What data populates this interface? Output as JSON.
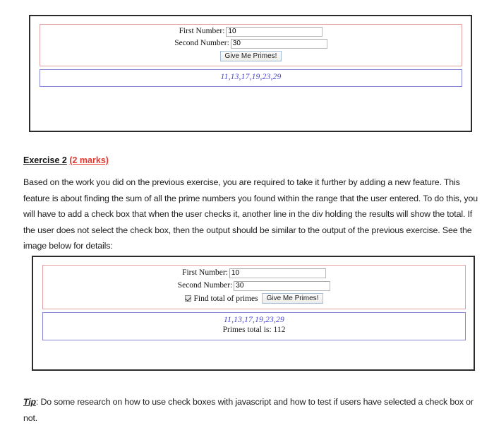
{
  "figure_1": {
    "name": "prime-finder-screenshot-basic",
    "form": {
      "first_number_label": "First Number:",
      "first_number_value": "10",
      "second_number_label": "Second Number:",
      "second_number_value": "30",
      "submit_label": "Give Me Primes!"
    },
    "results": {
      "primes_line": "11,13,17,19,23,29"
    }
  },
  "exercise": {
    "heading_main": "Exercise 2",
    "heading_marks": "(2 marks)",
    "paragraph": "Based on the work you did on the previous exercise, you are required to take it further by adding a new feature. This feature is about finding the sum of all the prime numbers you found within the range that the user entered. To do this, you will have to add a check box that when the user checks it, another line in the div holding the results will show the total. If the user does not select the check box, then the output should be similar to the output of the previous exercise. See the image below for details:"
  },
  "figure_2": {
    "name": "prime-finder-screenshot-with-total",
    "form": {
      "first_number_label": "First Number:",
      "first_number_value": "10",
      "second_number_label": "Second Number:",
      "second_number_value": "30",
      "checkbox_label": "Find total of primes",
      "checkbox_checked": true,
      "submit_label": "Give Me Primes!"
    },
    "results": {
      "primes_line": "11,13,17,19,23,29",
      "total_line": "Primes total is: 112"
    }
  },
  "tip": {
    "label": "Tip",
    "text": ": Do some research on how to use check boxes with javascript and how to test if users have selected a check box or not."
  },
  "colors": {
    "form_border": "#e3a2a2",
    "result_border": "#8686d6",
    "primes_text": "#4a4ad2",
    "marks_red": "#e03a30",
    "frame_border": "#2b2b2b"
  }
}
